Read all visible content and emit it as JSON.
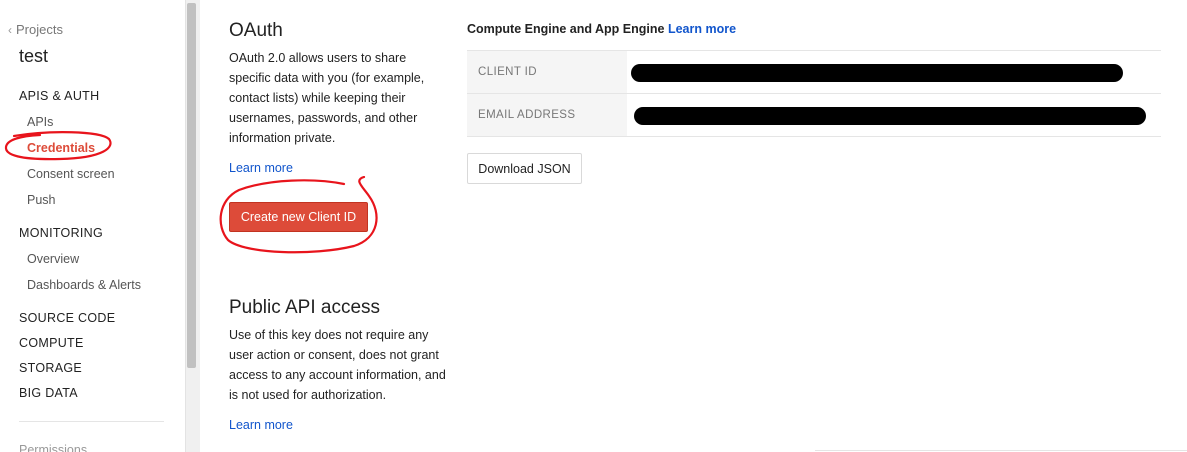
{
  "sidebar": {
    "back_label": "Projects",
    "project_name": "test",
    "sections": [
      {
        "label": "APIS & AUTH",
        "items": [
          "APIs",
          "Credentials",
          "Consent screen",
          "Push"
        ]
      },
      {
        "label": "MONITORING",
        "items": [
          "Overview",
          "Dashboards & Alerts"
        ]
      },
      {
        "label": "SOURCE CODE"
      },
      {
        "label": "COMPUTE"
      },
      {
        "label": "STORAGE"
      },
      {
        "label": "BIG DATA"
      }
    ],
    "active_item": "Credentials",
    "faded_item": "Permissions"
  },
  "oauth": {
    "title": "OAuth",
    "description": "OAuth 2.0 allows users to share specific data with you (for example, contact lists) while keeping their usernames, passwords, and other information private.",
    "learn_more": "Learn more",
    "create_button": "Create new Client ID"
  },
  "public_api": {
    "title": "Public API access",
    "description": "Use of this key does not require any user action or consent, does not grant access to any account information, and is not used for authorization.",
    "learn_more": "Learn more"
  },
  "credentials_panel": {
    "title": "Compute Engine and App Engine",
    "learn_more": "Learn more",
    "rows": [
      {
        "label": "CLIENT ID"
      },
      {
        "label": "EMAIL ADDRESS"
      }
    ],
    "download_button": "Download JSON"
  },
  "colors": {
    "accent_red": "#dd4b39",
    "link_blue": "#1155cc",
    "annotation_red": "#e8141c"
  }
}
